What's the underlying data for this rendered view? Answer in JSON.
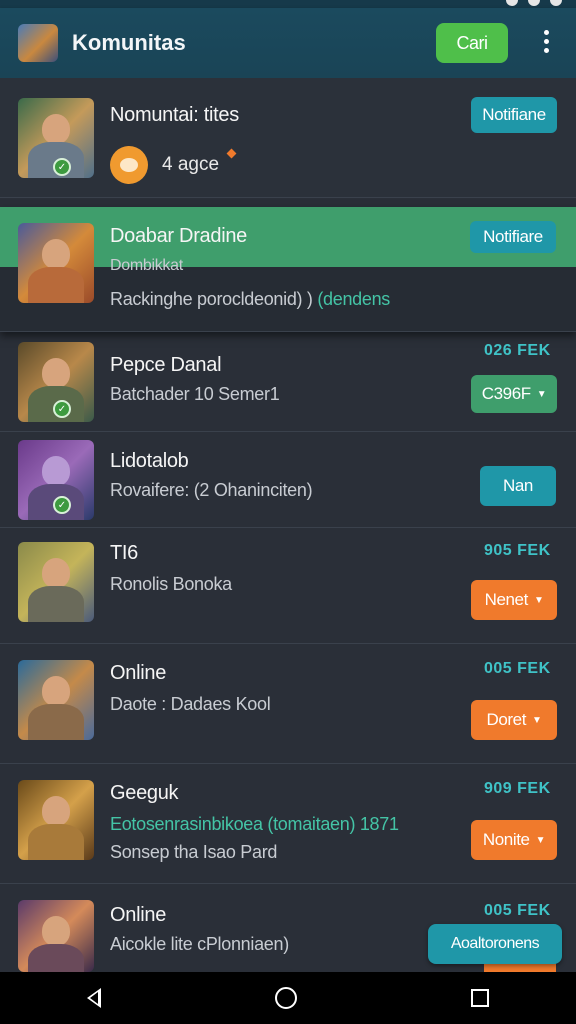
{
  "app_bar": {
    "title": "Komunitas",
    "search_button": "Cari"
  },
  "rows": [
    {
      "title": "Nomuntai: tites",
      "messages": "4 agce",
      "button": "Notifiane"
    },
    {
      "title": "Doabar Dradine",
      "subtitle": "Dombikkat",
      "detail": "Rackinghe porocldeonid) )",
      "detail_green": "(dendens",
      "button": "Notifiare"
    },
    {
      "title": "Pepce Danal",
      "subtitle": "Batchader 10 Semer1",
      "price": "026 FEK",
      "button": "C396F"
    },
    {
      "title": "Lidotalob",
      "subtitle": "Rovaifere: (2 Ohaninciten)",
      "button": "Nan"
    },
    {
      "title": "TI6",
      "subtitle": "Ronolis Bonoka",
      "price": "905 FEK",
      "button": "Nenet"
    },
    {
      "title": "Online",
      "subtitle": "Daote : Dadaes Kool",
      "price": "005 FEK",
      "button": "Doret"
    },
    {
      "title": "Geeguk",
      "subtitle": "Eotosenrasinbikoea (tomaitaen) 1871",
      "detail": "Sonsep tha Isao Pard",
      "price": "909 FEK",
      "button": "Nonite"
    },
    {
      "title": "Online",
      "subtitle": "Aicokle lite cPlonniaen)",
      "price": "005 FEK"
    }
  ],
  "fab": "Aoaltoronens",
  "icons": [
    "app-logo-icon",
    "more-vert-icon",
    "verified-check-icon",
    "chat-bubble-icon",
    "chevron-down-icon",
    "back-icon",
    "home-icon",
    "recents-icon"
  ],
  "colors": {
    "app_bar": "#1b4a5e",
    "background": "#2a2f38",
    "teal": "#1f97a8",
    "green": "#3f9e6c",
    "orange": "#f07a2c",
    "cari_green": "#4fbf4a"
  }
}
